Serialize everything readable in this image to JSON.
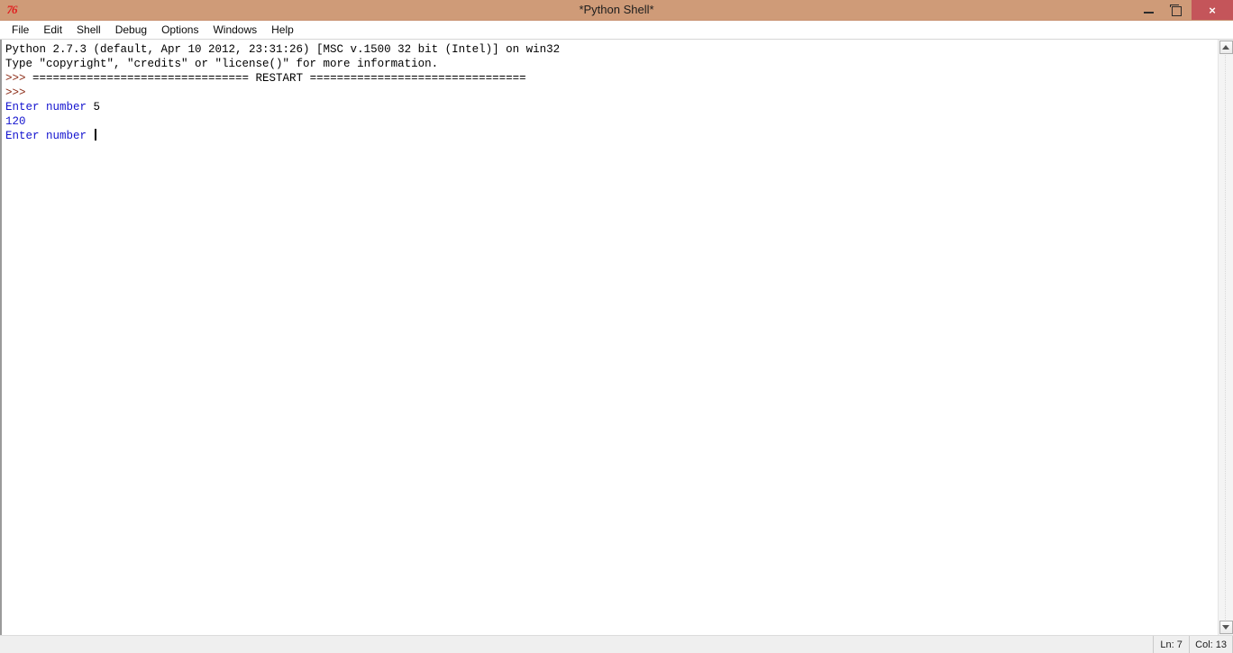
{
  "window": {
    "title": "*Python Shell*",
    "icon": "idle-python-icon",
    "titlebar_color": "#cf9b78",
    "controls": {
      "minimize_label": "Minimize",
      "restore_label": "Restore",
      "close_label": "×",
      "close_color": "#c4555a"
    }
  },
  "menubar": {
    "items": [
      {
        "label": "File"
      },
      {
        "label": "Edit"
      },
      {
        "label": "Shell"
      },
      {
        "label": "Debug"
      },
      {
        "label": "Options"
      },
      {
        "label": "Windows"
      },
      {
        "label": "Help"
      }
    ]
  },
  "shell": {
    "text_colors": {
      "normal": "#000000",
      "prompt": "#8b2a15",
      "output": "#1414cf"
    },
    "lines": [
      {
        "segments": [
          {
            "text": "Python 2.7.3 (default, Apr 10 2012, 23:31:26) [MSC v.1500 32 bit (Intel)] on win32",
            "color": "normal"
          }
        ]
      },
      {
        "segments": [
          {
            "text": "Type \"copyright\", \"credits\" or \"license()\" for more information.",
            "color": "normal"
          }
        ]
      },
      {
        "segments": [
          {
            "text": ">>> ",
            "color": "prompt"
          },
          {
            "text": "================================ RESTART ================================",
            "color": "normal"
          }
        ]
      },
      {
        "segments": [
          {
            "text": ">>> ",
            "color": "prompt"
          }
        ]
      },
      {
        "segments": [
          {
            "text": "Enter number ",
            "color": "output"
          },
          {
            "text": "5",
            "color": "normal"
          }
        ]
      },
      {
        "segments": [
          {
            "text": "120",
            "color": "output"
          }
        ]
      },
      {
        "segments": [
          {
            "text": "Enter number ",
            "color": "output"
          }
        ],
        "caret": true
      }
    ]
  },
  "scrollbar": {
    "up_arrow": "scroll-up-icon",
    "down_arrow": "scroll-down-icon"
  },
  "statusbar": {
    "line_label": "Ln: 7",
    "col_label": "Col: 13"
  }
}
